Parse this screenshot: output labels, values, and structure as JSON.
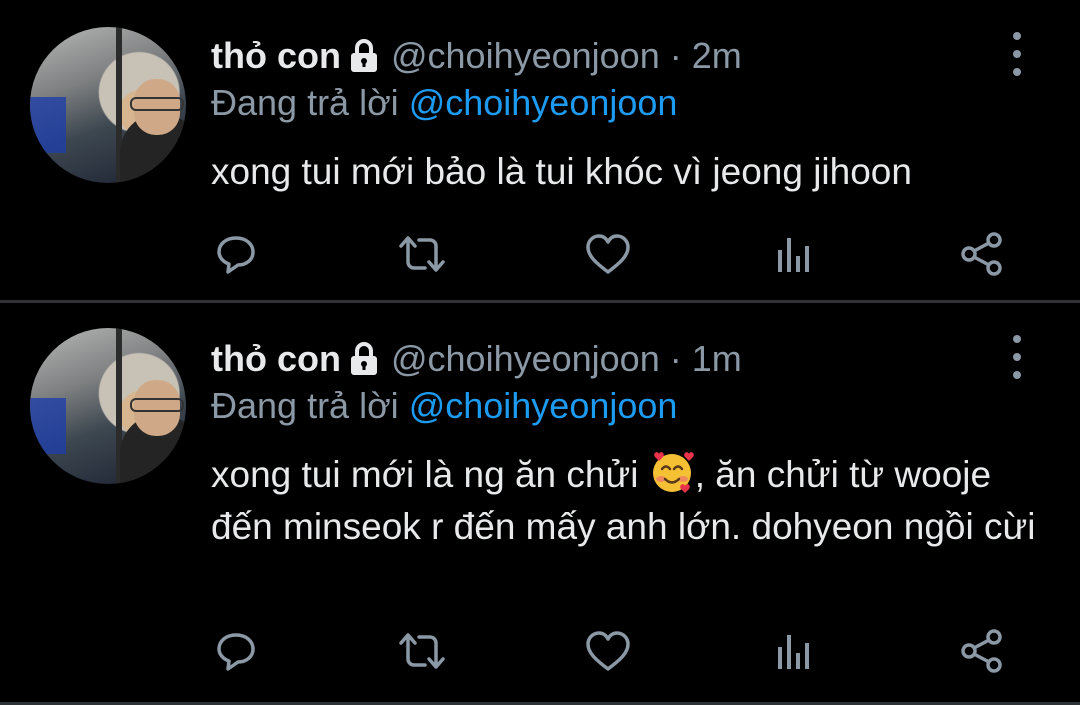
{
  "tweets": [
    {
      "name": "thỏ con",
      "handle": "@choihyeonjoon",
      "separator": "·",
      "time": "2m",
      "reply_prefix": "Đang trả lời",
      "reply_handle": "@choihyeonjoon",
      "text": "xong tui mới bảo là tui khóc vì jeong jihoon"
    },
    {
      "name": "thỏ con",
      "handle": "@choihyeonjoon",
      "separator": "·",
      "time": "1m",
      "reply_prefix": "Đang trả lời",
      "reply_handle": "@choihyeonjoon",
      "text_before_emoji": "xong tui mới là ng ăn chửi ",
      "emoji": "smiling-face-with-hearts",
      "text_after_emoji": ", ăn chửi từ wooje đến minseok r đến mấy anh lớn. dohyeon ngồi cừi"
    }
  ],
  "icons": {
    "lock": "lock-icon",
    "more": "more-vertical-icon",
    "reply": "reply-icon",
    "retweet": "retweet-icon",
    "like": "heart-icon",
    "analytics": "analytics-icon",
    "share": "share-icon"
  },
  "colors": {
    "background": "#000000",
    "text": "#e7e9ea",
    "muted": "#8b98a5",
    "link": "#1d9bf0",
    "divider": "#2f3336"
  }
}
